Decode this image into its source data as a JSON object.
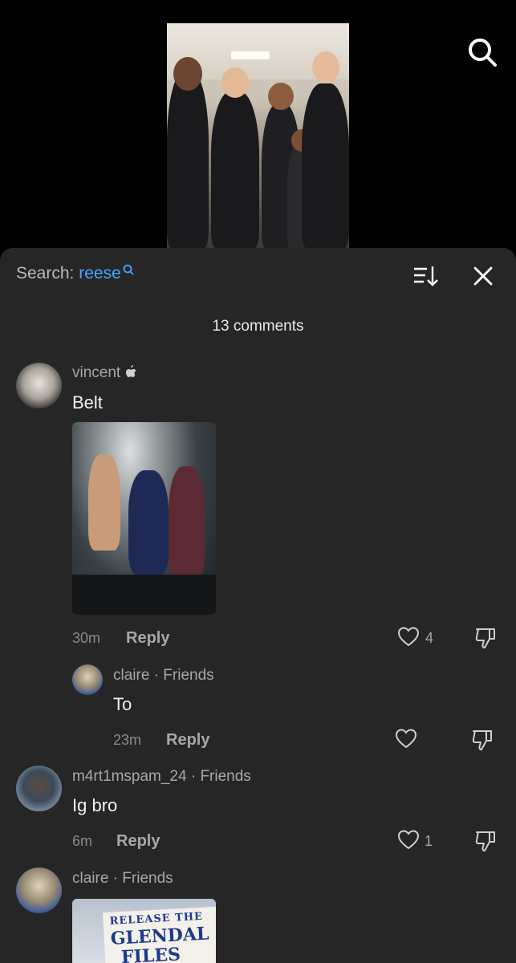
{
  "search": {
    "label": "Search:",
    "term": "reese"
  },
  "header": {
    "comment_count": "13 comments"
  },
  "comments": [
    {
      "username": "vincent",
      "badge": "apple",
      "text": "Belt",
      "time": "30m",
      "reply_label": "Reply",
      "likes": "4"
    },
    {
      "username": "claire · Friends",
      "text": "To",
      "time": "23m",
      "reply_label": "Reply",
      "likes": ""
    },
    {
      "username": "m4rt1mspam_24 · Friends",
      "text": "Ig bro",
      "time": "6m",
      "reply_label": "Reply",
      "likes": "1"
    },
    {
      "username": "claire · Friends",
      "sign_lines": [
        "RELEASE THE",
        "GLENDAL",
        "FILES"
      ]
    }
  ],
  "colors": {
    "accent": "#4aa3ff",
    "sheet": "#262626",
    "background": "#000000"
  },
  "icons": [
    "search-icon",
    "sort-icon",
    "close-icon",
    "heart-icon",
    "dislike-icon",
    "apple-icon"
  ]
}
